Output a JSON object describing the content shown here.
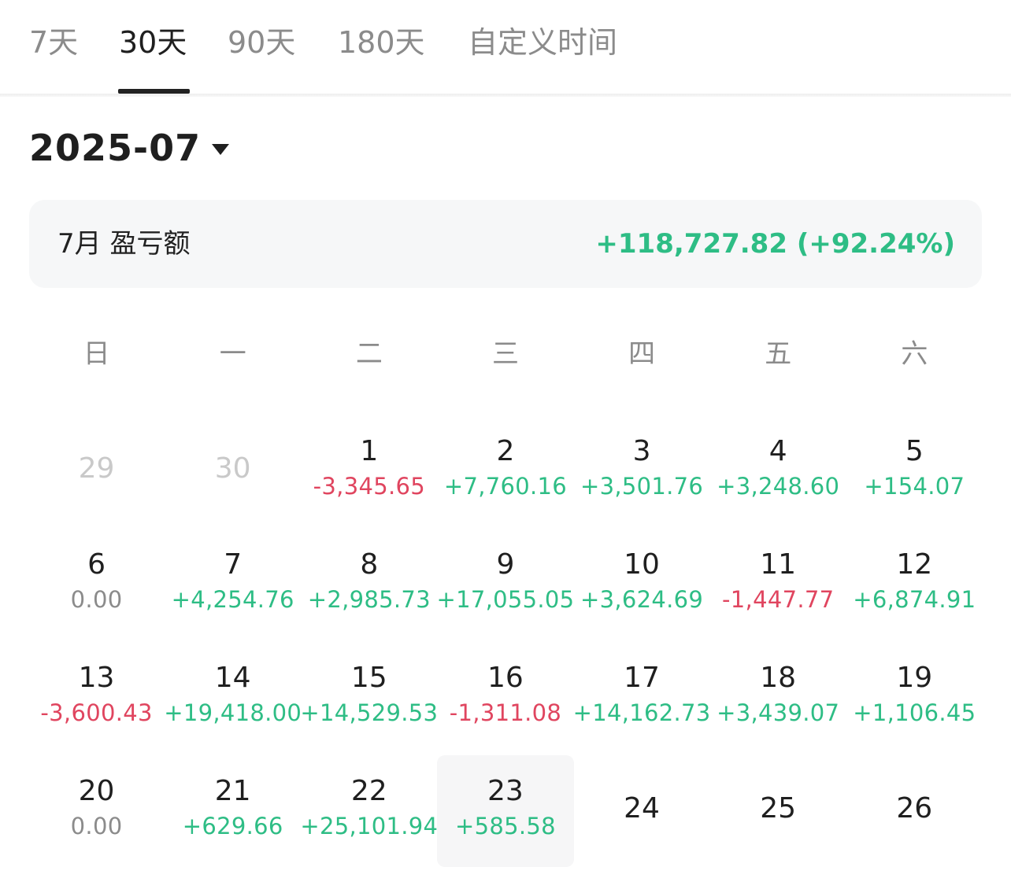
{
  "tabs": [
    {
      "label": "7天",
      "active": false
    },
    {
      "label": "30天",
      "active": true
    },
    {
      "label": "90天",
      "active": false
    },
    {
      "label": "180天",
      "active": false
    },
    {
      "label": "自定义时间",
      "active": false
    }
  ],
  "month_picker": {
    "value": "2025-07"
  },
  "summary": {
    "label": "7月 盈亏额",
    "value": "+118,727.82 (+92.24%)"
  },
  "weekdays": [
    "日",
    "一",
    "二",
    "三",
    "四",
    "五",
    "六"
  ],
  "calendar": {
    "weeks": [
      [
        {
          "day": "29",
          "pnl": "",
          "muted": true
        },
        {
          "day": "30",
          "pnl": "",
          "muted": true
        },
        {
          "day": "1",
          "pnl": "-3,345.65"
        },
        {
          "day": "2",
          "pnl": "+7,760.16"
        },
        {
          "day": "3",
          "pnl": "+3,501.76"
        },
        {
          "day": "4",
          "pnl": "+3,248.60"
        },
        {
          "day": "5",
          "pnl": "+154.07"
        }
      ],
      [
        {
          "day": "6",
          "pnl": "0.00"
        },
        {
          "day": "7",
          "pnl": "+4,254.76"
        },
        {
          "day": "8",
          "pnl": "+2,985.73"
        },
        {
          "day": "9",
          "pnl": "+17,055.05"
        },
        {
          "day": "10",
          "pnl": "+3,624.69"
        },
        {
          "day": "11",
          "pnl": "-1,447.77"
        },
        {
          "day": "12",
          "pnl": "+6,874.91"
        }
      ],
      [
        {
          "day": "13",
          "pnl": "-3,600.43"
        },
        {
          "day": "14",
          "pnl": "+19,418.00"
        },
        {
          "day": "15",
          "pnl": "+14,529.53"
        },
        {
          "day": "16",
          "pnl": "-1,311.08"
        },
        {
          "day": "17",
          "pnl": "+14,162.73"
        },
        {
          "day": "18",
          "pnl": "+3,439.07"
        },
        {
          "day": "19",
          "pnl": "+1,106.45"
        }
      ],
      [
        {
          "day": "20",
          "pnl": "0.00"
        },
        {
          "day": "21",
          "pnl": "+629.66"
        },
        {
          "day": "22",
          "pnl": "+25,101.94"
        },
        {
          "day": "23",
          "pnl": "+585.58",
          "today": true
        },
        {
          "day": "24",
          "pnl": ""
        },
        {
          "day": "25",
          "pnl": ""
        },
        {
          "day": "26",
          "pnl": ""
        }
      ]
    ]
  },
  "colors": {
    "positive": "#2ebd85",
    "negative": "#e0455f",
    "neutral": "#8b8b8b"
  },
  "icons": {
    "month_dropdown": "caret-down-icon"
  }
}
